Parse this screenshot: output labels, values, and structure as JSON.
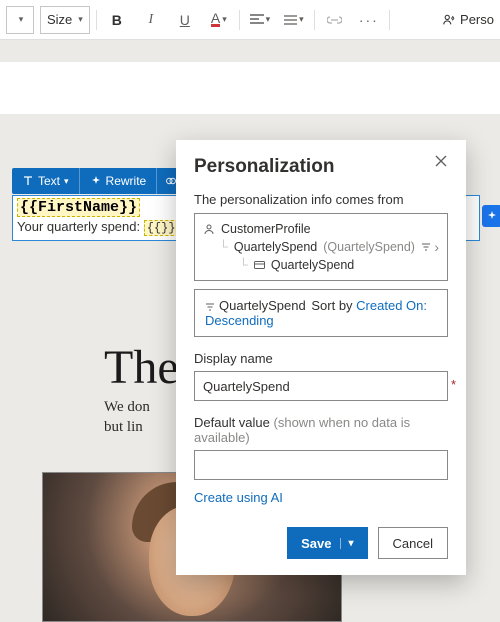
{
  "toolbar": {
    "size_label": "Size",
    "bold": "B",
    "italic": "I",
    "underline": "U",
    "font_a": "A",
    "perso_label": "Perso"
  },
  "floating": {
    "text": "Text",
    "rewrite": "Rewrite"
  },
  "editor": {
    "token_firstname": "{{FirstName}}",
    "spend_prefix": "Your quarterly spend: ",
    "spend_token": "{{}}"
  },
  "hero": {
    "title_partial": "The",
    "sub_line1": "We don",
    "sub_line2": "but lin"
  },
  "panel": {
    "title": "Personalization",
    "source_heading": "The personalization info comes from",
    "tree": {
      "root": "CustomerProfile",
      "level1": "QuartelySpend",
      "level1_paren": "(QuartelySpend)",
      "level2": "QuartelySpend"
    },
    "sort": {
      "entity": "QuartelySpend",
      "label": "Sort by",
      "link": "Created On: Descending"
    },
    "display_name_label": "Display name",
    "display_name_value": "QuartelySpend",
    "default_label": "Default value",
    "default_hint": "(shown when no data is available)",
    "default_value": "",
    "ai_link": "Create using AI",
    "save": "Save",
    "cancel": "Cancel"
  }
}
